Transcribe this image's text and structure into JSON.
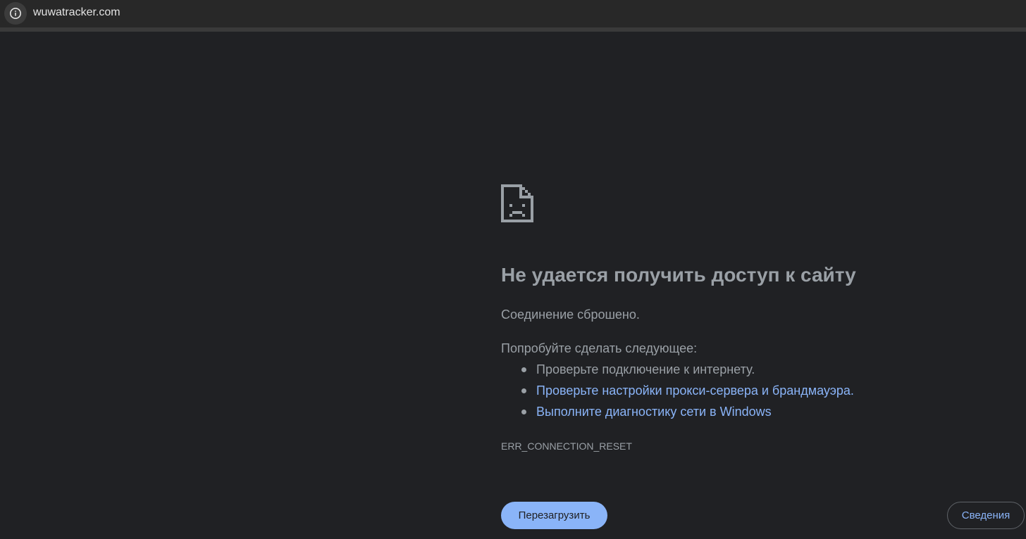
{
  "omnibox": {
    "site_info_icon": "info-circle-icon",
    "url": "wuwatracker.com"
  },
  "error": {
    "icon": "sad-page-icon",
    "title": "Не удается получить доступ к сайту",
    "subtitle": "Соединение сброшено.",
    "suggestions_heading": "Попробуйте сделать следующее:",
    "suggestions": [
      {
        "text": "Проверьте подключение к интернету."
      },
      {
        "text": "Проверьте настройки прокси-сервера и брандмауэра."
      },
      {
        "text": "Выполните диагностику сети в Windows"
      }
    ],
    "code": "ERR_CONNECTION_RESET"
  },
  "buttons": {
    "reload": "Перезагрузить",
    "details": "Сведения"
  },
  "colors": {
    "background": "#202124",
    "text": "#9aa0a6",
    "link": "#8ab4f8",
    "button_primary": "#8ab4f8"
  }
}
